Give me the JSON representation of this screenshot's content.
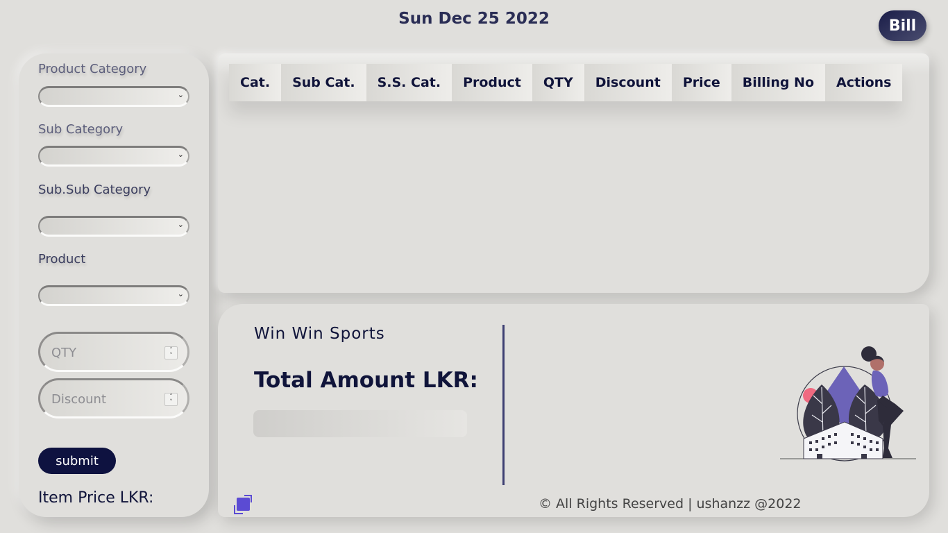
{
  "header": {
    "date": "Sun Dec 25 2022",
    "bill_label": "Bill"
  },
  "form": {
    "category_label": "Product Category",
    "sub_category_label": "Sub Category",
    "sub_sub_category_label": "Sub.Sub Category",
    "product_label": "Product",
    "qty_placeholder": "QTY",
    "discount_placeholder": "Discount",
    "submit_label": "submit",
    "item_price_label": "Item Price LKR:"
  },
  "table": {
    "columns": [
      "Cat.",
      "Sub Cat.",
      "S.S. Cat.",
      "Product",
      "QTY",
      "Discount",
      "Price",
      "Billing No",
      "Actions"
    ],
    "rows": []
  },
  "summary": {
    "shop_name": "Win Win Sports",
    "total_label": "Total Amount LKR:",
    "total_value": ""
  },
  "footer": {
    "copyright": "© All Rights Reserved | ushanzz @2022"
  },
  "colors": {
    "background": "#e0dfdc",
    "primary": "#10143a",
    "accent_purple": "#5b4bd3",
    "illustration_accent": "#6c63b8",
    "illustration_pink": "#f06a80"
  }
}
